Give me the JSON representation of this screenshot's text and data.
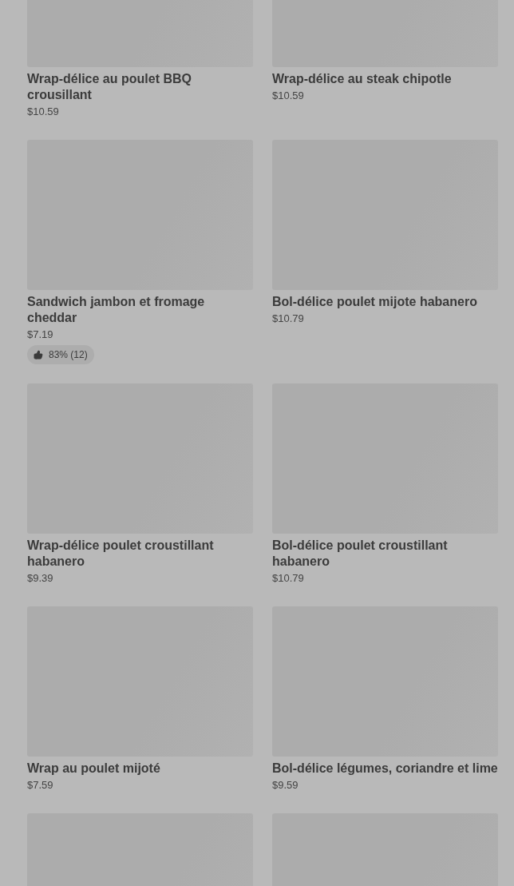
{
  "items": [
    {
      "kind": "product",
      "name": "Wrap-délice au poulet BBQ crousillant",
      "price": "$10.59"
    },
    {
      "kind": "product",
      "name": "Wrap-délice au steak chipotle",
      "price": "$10.59"
    },
    {
      "kind": "product",
      "name": "Sandwich jambon et fromage cheddar",
      "price": "$7.19",
      "rating": "83% (12)"
    },
    {
      "kind": "product",
      "name": "Bol-délice poulet mijote habanero",
      "price": "$10.79"
    },
    {
      "kind": "product",
      "name": "Wrap-délice poulet croustillant habanero",
      "price": "$9.39"
    },
    {
      "kind": "product",
      "name": "Bol-délice poulet croustillant habanero",
      "price": "$10.79"
    },
    {
      "kind": "product",
      "name": "Wrap au poulet mijoté",
      "price": "$7.59"
    },
    {
      "kind": "product",
      "name": "Bol-délice légumes, coriandre et lime",
      "price": "$9.59"
    },
    {
      "kind": "image_only"
    },
    {
      "kind": "image_only"
    }
  ]
}
